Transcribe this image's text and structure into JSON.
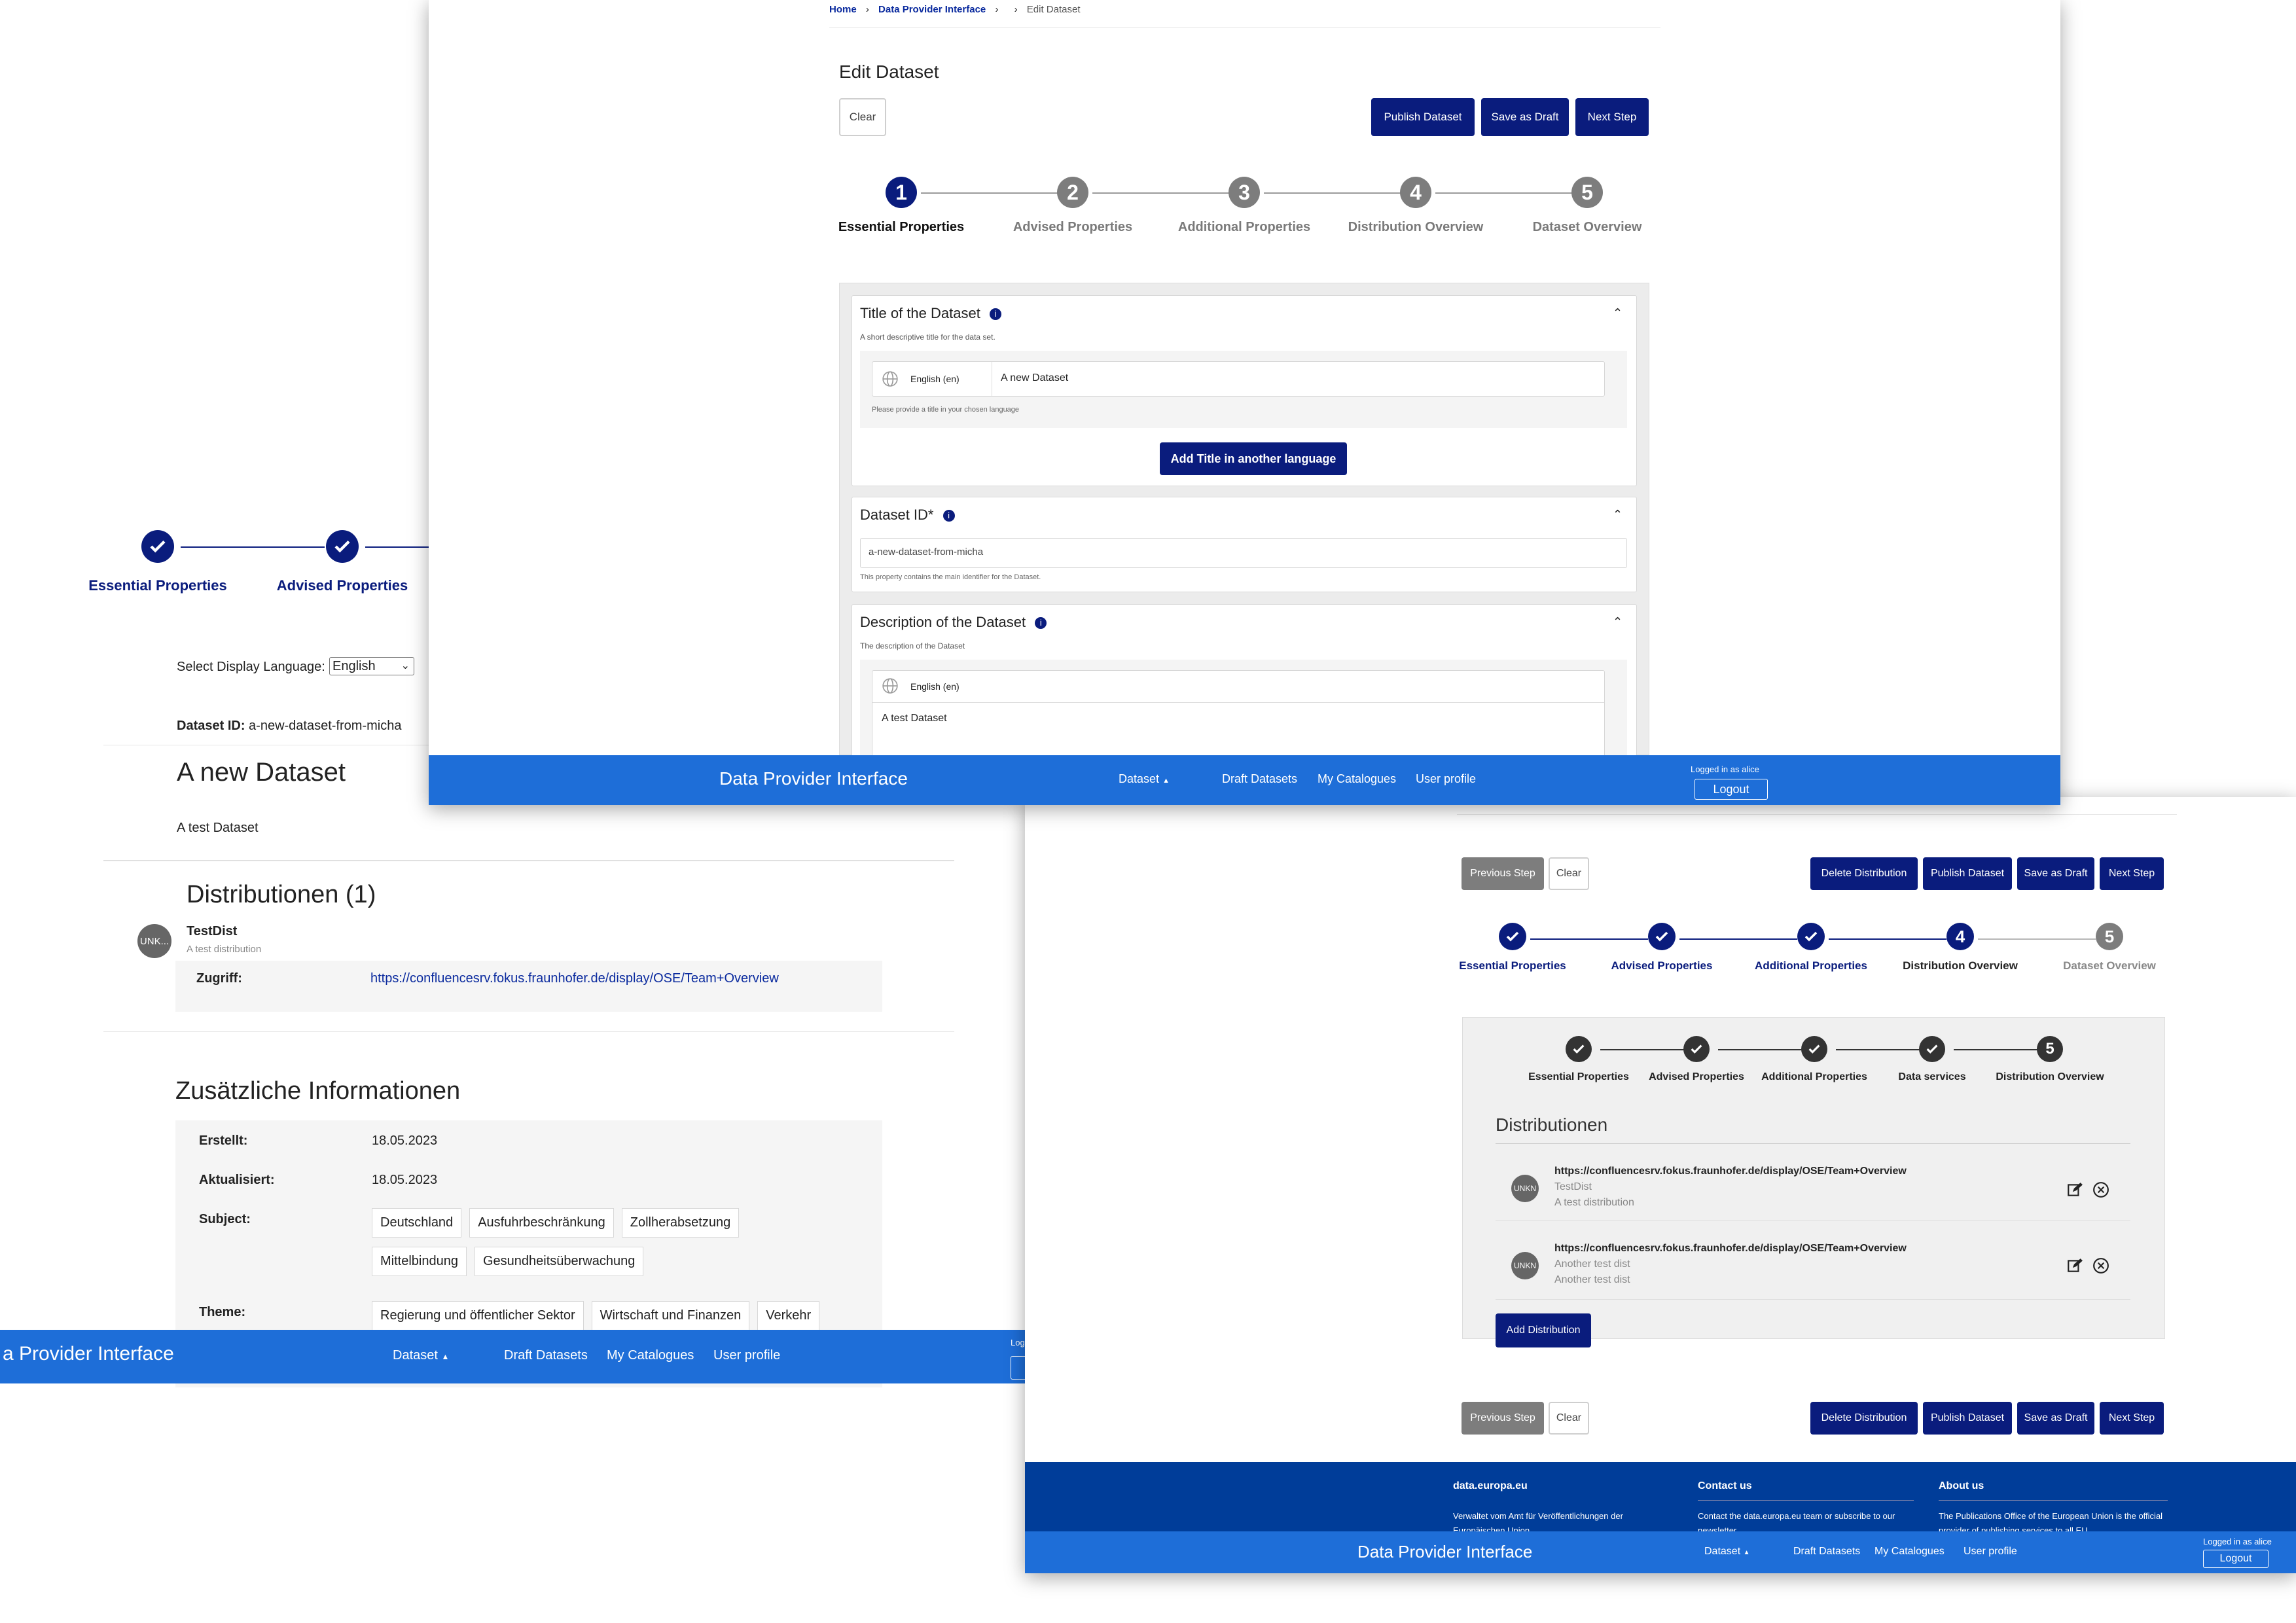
{
  "left": {
    "stepper": {
      "step1": "Essential Properties",
      "step2": "Advised Properties"
    },
    "language": {
      "label": "Select Display Language:",
      "value": "English"
    },
    "dataset_id": {
      "label": "Dataset ID:",
      "value": "a-new-dataset-from-micha"
    },
    "title": "A new Dataset",
    "description": "A test Dataset",
    "distributions": {
      "heading": "Distributionen (1)",
      "item": {
        "avatar": "UNK...",
        "name": "TestDist",
        "desc": "A test distribution",
        "access_label": "Zugriff:",
        "access_link": "https://confluencesrv.fokus.fraunhofer.de/display/OSE/Team+Overview"
      }
    },
    "additional": {
      "heading": "Zusätzliche Informationen",
      "created_label": "Erstellt:",
      "created": "18.05.2023",
      "updated_label": "Aktualisiert:",
      "updated": "18.05.2023",
      "subject_label": "Subject:",
      "subjects": [
        "Deutschland",
        "Ausfuhrbeschränkung",
        "Zollherabsetzung",
        "Mittelbindung",
        "Gesundheitsüberwachung"
      ],
      "theme_label": "Theme:",
      "themes": [
        "Regierung und öffentlicher Sektor",
        "Wirtschaft und Finanzen",
        "Verkehr"
      ]
    },
    "navbar": {
      "brand": "a Provider Interface",
      "dataset": "Dataset",
      "drafts": "Draft Datasets",
      "catalogues": "My Catalogues",
      "profile": "User profile",
      "logged": "Logg"
    }
  },
  "top": {
    "breadcrumb": {
      "home": "Home",
      "dpi": "Data Provider Interface",
      "current": "Edit Dataset"
    },
    "heading": "Edit Dataset",
    "buttons": {
      "clear": "Clear",
      "publish": "Publish Dataset",
      "draft": "Save as Draft",
      "next": "Next Step"
    },
    "steps": [
      {
        "num": "1",
        "label": "Essential Properties"
      },
      {
        "num": "2",
        "label": "Advised Properties"
      },
      {
        "num": "3",
        "label": "Additional Properties"
      },
      {
        "num": "4",
        "label": "Distribution Overview"
      },
      {
        "num": "5",
        "label": "Dataset Overview"
      }
    ],
    "title_section": {
      "heading": "Title of the Dataset",
      "hint": "A short descriptive title for the data set.",
      "lang": "English (en)",
      "value": "A new Dataset",
      "note": "Please provide a title in your chosen language",
      "add_button": "Add Title in another language"
    },
    "id_section": {
      "heading": "Dataset ID*",
      "value": "a-new-dataset-from-micha",
      "hint": "This property contains the main identifier for the Dataset."
    },
    "desc_section": {
      "heading": "Description of the Dataset",
      "hint": "The description of the Dataset",
      "lang": "English (en)",
      "value": "A test Dataset"
    },
    "navbar": {
      "brand": "Data Provider Interface",
      "dataset": "Dataset",
      "drafts": "Draft Datasets",
      "catalogues": "My Catalogues",
      "profile": "User profile",
      "logged": "Logged in as alice",
      "logout": "Logout"
    }
  },
  "bottom": {
    "buttons": {
      "prev": "Previous Step",
      "clear": "Clear",
      "delete": "Delete Distribution",
      "publish": "Publish Dataset",
      "draft": "Save as Draft",
      "next": "Next Step"
    },
    "steps": [
      {
        "label": "Essential Properties"
      },
      {
        "label": "Advised Properties"
      },
      {
        "label": "Additional Properties"
      },
      {
        "num": "4",
        "label": "Distribution Overview"
      },
      {
        "num": "5",
        "label": "Dataset Overview"
      }
    ],
    "inner_steps": [
      {
        "label": "Essential Properties"
      },
      {
        "label": "Advised Properties"
      },
      {
        "label": "Additional Properties"
      },
      {
        "label": "Data services"
      },
      {
        "num": "5",
        "label": "Distribution Overview"
      }
    ],
    "distributions_heading": "Distributionen",
    "distributions": [
      {
        "avatar": "UNKN",
        "url": "https://confluencesrv.fokus.fraunhofer.de/display/OSE/Team+Overview",
        "name": "TestDist",
        "desc": "A test distribution"
      },
      {
        "avatar": "UNKN",
        "url": "https://confluencesrv.fokus.fraunhofer.de/display/OSE/Team+Overview",
        "name": "Another test dist",
        "desc": "Another test dist"
      }
    ],
    "add_button": "Add Distribution",
    "footer": {
      "col1_title": "data.europa.eu",
      "col1_text": "Verwaltet vom Amt für Veröffentlichungen der Europäischen Union",
      "col2_title": "Contact us",
      "col2_text": "Contact the data.europa.eu team or subscribe to our newsletter",
      "col3_title": "About us",
      "col3_text": "The Publications Office of the European Union is the official provider of publishing services to all EU"
    },
    "navbar": {
      "brand": "Data Provider Interface",
      "dataset": "Dataset",
      "drafts": "Draft Datasets",
      "catalogues": "My Catalogues",
      "profile": "User profile",
      "logged": "Logged in as alice",
      "logout": "Logout"
    }
  }
}
